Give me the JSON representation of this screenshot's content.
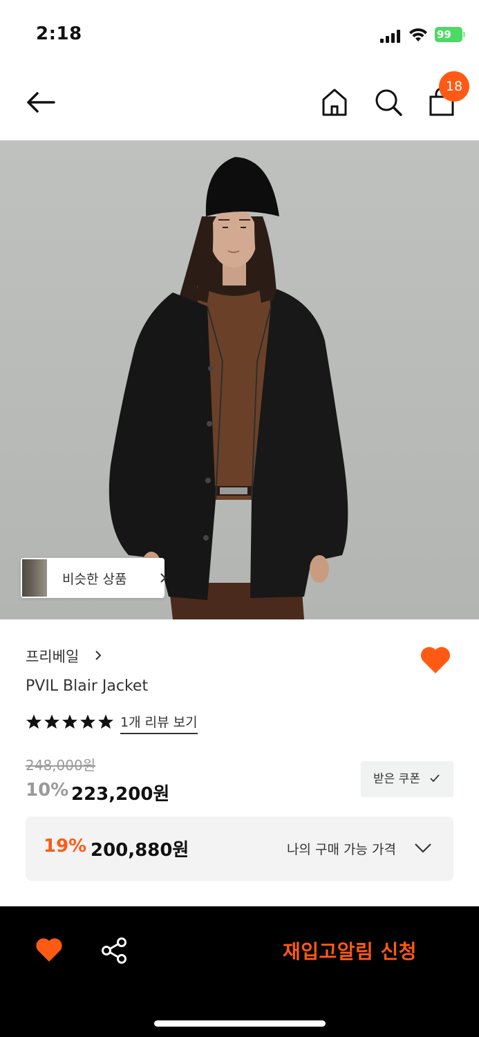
{
  "status_bar": {
    "time": "2:18",
    "battery": "99"
  },
  "nav": {
    "back_icon": "arrow-left-icon",
    "home_icon": "home-icon",
    "search_icon": "search-icon",
    "bag_icon": "shopping-bag-icon",
    "bag_count": "18"
  },
  "hero": {
    "similar_label": "비슷한 상품"
  },
  "product": {
    "brand": "프리베일",
    "name": "PVIL Blair Jacket",
    "rating_stars": 5,
    "review_link": "1개 리뷰 보기",
    "original_price": "248,000원",
    "discount_percent": "10%",
    "sale_price": "223,200원",
    "coupon_button": "받은 쿠폰",
    "my_price": {
      "percent": "19%",
      "price": "200,880원",
      "label": "나의 구매 가능 가격"
    }
  },
  "bottom_bar": {
    "cta_label": "재입고알림 신청"
  },
  "colors": {
    "accent": "#ff5a14",
    "bottom_bar_bg": "#000000",
    "battery_green": "#4cd964"
  }
}
